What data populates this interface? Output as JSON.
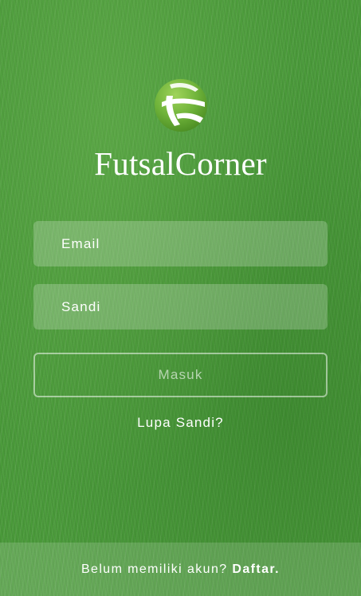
{
  "app": {
    "logo_icon": "futsal-ball-logo-icon",
    "name": "FutsalCorner"
  },
  "login_form": {
    "email_placeholder": "Email",
    "email_value": "",
    "password_placeholder": "Sandi",
    "password_value": "",
    "submit_label": "Masuk",
    "forgot_password_label": "Lupa Sandi?"
  },
  "footer": {
    "prompt_text": "Belum memiliki akun?",
    "signup_link_label": "Daftar."
  },
  "colors": {
    "grass_background": "#4a9a3a",
    "logo_green": "#6fb33a",
    "text": "#ffffff"
  }
}
